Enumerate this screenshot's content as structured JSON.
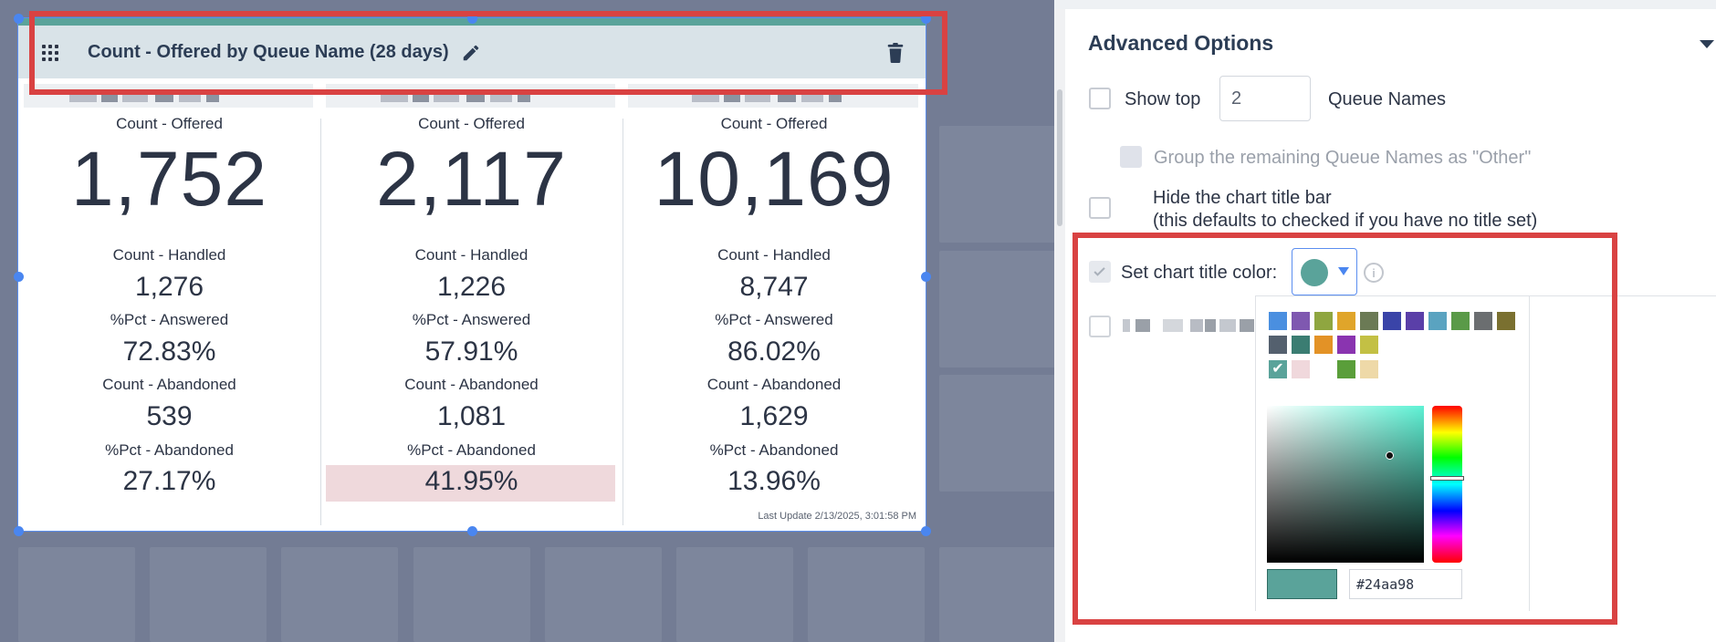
{
  "widget": {
    "title": "Count - Offered by Queue Name (28 days)",
    "last_update": "Last Update 2/13/2025, 3:01:58 PM",
    "columns": [
      {
        "offered_label": "Count - Offered",
        "offered": "1,752",
        "handled_label": "Count - Handled",
        "handled": "1,276",
        "answered_label": "%Pct - Answered",
        "answered": "72.83%",
        "abandoned_label": "Count - Abandoned",
        "abandoned": "539",
        "pct_abandoned_label": "%Pct - Abandoned",
        "pct_abandoned": "27.17%"
      },
      {
        "offered_label": "Count - Offered",
        "offered": "2,117",
        "handled_label": "Count - Handled",
        "handled": "1,226",
        "answered_label": "%Pct - Answered",
        "answered": "57.91%",
        "abandoned_label": "Count - Abandoned",
        "abandoned": "1,081",
        "pct_abandoned_label": "%Pct - Abandoned",
        "pct_abandoned": "41.95%"
      },
      {
        "offered_label": "Count - Offered",
        "offered": "10,169",
        "handled_label": "Count - Handled",
        "handled": "8,747",
        "answered_label": "%Pct - Answered",
        "answered": "86.02%",
        "abandoned_label": "Count - Abandoned",
        "abandoned": "1,629",
        "pct_abandoned_label": "%Pct - Abandoned",
        "pct_abandoned": "13.96%"
      }
    ],
    "highlight_color": "#efd9dc",
    "title_color": "#5aa39a"
  },
  "panel": {
    "section_title": "Advanced Options",
    "show_top_label": "Show top",
    "show_top_value": "2",
    "show_top_suffix": "Queue Names",
    "group_remaining_label": "Group the remaining Queue Names as \"Other\"",
    "hide_title_label": "Hide the chart title bar",
    "hide_title_note": "(this defaults to checked if you have no title set)",
    "title_color_label": "Set chart title color:",
    "info_glyph": "i",
    "check_glyph": "✔"
  },
  "color_picker": {
    "hex_value": "#24aa98",
    "selected_color": "#5aa39a",
    "palette": [
      [
        "#4a8fe0",
        "#7f58b0",
        "#8fa640",
        "#e0a52a",
        "#6b7a55",
        "#3a44a8",
        "#5a3fa8",
        "#5aa3c0",
        "#5a9a48",
        "#6b6e70",
        "#7a7030"
      ],
      [
        "#54606e",
        "#3b7d72",
        "#e39226",
        "#8a34b0",
        "#c3c044"
      ],
      [
        "#5aa39a",
        "#f0d8dc",
        "",
        "#5a9e3a",
        "#eed9a8"
      ]
    ]
  }
}
